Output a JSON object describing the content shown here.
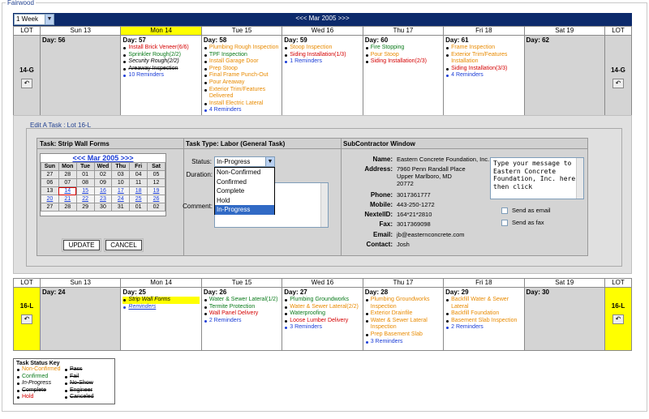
{
  "page": {
    "fieldset_label": "Fairwood"
  },
  "top_calendar": {
    "week_select": "1 Week",
    "month_nav": "<<< Mar 2005 >>>",
    "lot_header": "LOT",
    "lot": "14-G",
    "days": [
      {
        "header": "Sun 13",
        "day": "Day: 56",
        "gray": true,
        "tasks": []
      },
      {
        "header": "Mon 14",
        "day": "Day: 57",
        "today": true,
        "tasks": [
          {
            "text": "Install Brick Veneer(6/6)",
            "cls": "c-red"
          },
          {
            "text": "Sprinkler Rough(2/2)",
            "cls": "c-green"
          },
          {
            "text": "Security Rough(2/2)",
            "cls": "c-italic"
          },
          {
            "text": "Areaway Inspection",
            "cls": "c-strike"
          },
          {
            "text": "10 Reminders",
            "cls": "c-blue",
            "rem": true
          }
        ]
      },
      {
        "header": "Tue 15",
        "day": "Day: 58",
        "tasks": [
          {
            "text": "Plumbing Rough Inspection",
            "cls": "c-orange"
          },
          {
            "text": "TPF Inspection",
            "cls": "c-green"
          },
          {
            "text": "Install Garage Door",
            "cls": "c-orange"
          },
          {
            "text": "Prep Stoop",
            "cls": "c-orange"
          },
          {
            "text": "Final Frame Punch-Out",
            "cls": "c-orange"
          },
          {
            "text": "Pour Areaway",
            "cls": "c-orange"
          },
          {
            "text": "Exterior Trim/Features Delivered",
            "cls": "c-orange"
          },
          {
            "text": "Install Electric Lateral",
            "cls": "c-orange"
          },
          {
            "text": "4 Reminders",
            "cls": "c-blue",
            "rem": true
          }
        ]
      },
      {
        "header": "Wed 16",
        "day": "Day: 59",
        "tasks": [
          {
            "text": "Stoop Inspection",
            "cls": "c-orange"
          },
          {
            "text": "Siding Installation(1/3)",
            "cls": "c-red"
          },
          {
            "text": "1 Reminders",
            "cls": "c-blue",
            "rem": true
          }
        ]
      },
      {
        "header": "Thu 17",
        "day": "Day: 60",
        "tasks": [
          {
            "text": "Fire Stopping",
            "cls": "c-green"
          },
          {
            "text": "Pour Stoop",
            "cls": "c-orange"
          },
          {
            "text": "Siding Installation(2/3)",
            "cls": "c-red"
          }
        ]
      },
      {
        "header": "Fri 18",
        "day": "Day: 61",
        "tasks": [
          {
            "text": "Frame Inspection",
            "cls": "c-orange"
          },
          {
            "text": "Exterior Trim/Features Installation",
            "cls": "c-orange"
          },
          {
            "text": "Siding Installation(3/3)",
            "cls": "c-red"
          },
          {
            "text": "4 Reminders",
            "cls": "c-blue",
            "rem": true
          }
        ]
      },
      {
        "header": "Sat 19",
        "day": "Day: 62",
        "gray": true,
        "tasks": []
      }
    ]
  },
  "edit": {
    "legend": "Edit A Task : Lot 16-L",
    "task_title": "Task: Strip Wall Forms",
    "task_type": "Task Type: Labor (General Task)",
    "sub_window": "SubContractor Window",
    "mini_month": "<<< Mar 2005 >>>",
    "dow": [
      "Sun",
      "Mon",
      "Tue",
      "Wed",
      "Thu",
      "Fri",
      "Sat"
    ],
    "weeks": [
      [
        "27",
        "28",
        "01",
        "02",
        "03",
        "04",
        "05"
      ],
      [
        "06",
        "07",
        "08",
        "09",
        "10",
        "11",
        "12"
      ],
      [
        "13",
        "14",
        "15",
        "16",
        "17",
        "18",
        "19"
      ],
      [
        "20",
        "21",
        "22",
        "23",
        "24",
        "25",
        "26"
      ],
      [
        "27",
        "28",
        "29",
        "30",
        "31",
        "01",
        "02"
      ]
    ],
    "update_label": "UPDATE",
    "cancel_label": "CANCEL",
    "status_label": "Status:",
    "duration_label": "Duration:",
    "comment_label": "Comment:",
    "status_value": "In-Progress",
    "status_options": [
      "Non-Confirmed",
      "Confirmed",
      "Complete",
      "Hold",
      "In-Progress"
    ],
    "sub": {
      "name_label": "Name:",
      "name": "Eastern Concrete Foundation, Inc.",
      "address_label": "Address:",
      "address1": "7960 Penn Randall Place",
      "address2": "Upper Marlboro, MD",
      "address3": "20772",
      "phone_label": "Phone:",
      "phone": "3017361777",
      "mobile_label": "Mobile:",
      "mobile": "443-250-1272",
      "nextel_label": "NextelID:",
      "nextel": "164*21*2810",
      "fax_label": "Fax:",
      "fax": "3017369098",
      "email_label": "Email:",
      "email": "jb@easternconcrete.com",
      "contact_label": "Contact:",
      "contact": "Josh",
      "message": "Type your message to Eastern Concrete Foundation, Inc. here, then click",
      "send_email": "Send as email",
      "send_fax": "Send as fax"
    }
  },
  "bottom_calendar": {
    "lot_header": "LOT",
    "lot": "16-L",
    "days": [
      {
        "header": "Sun 13",
        "day": "Day: 24",
        "gray": true,
        "tasks": []
      },
      {
        "header": "Mon 14",
        "day": "Day: 25",
        "tasks": [
          {
            "text": "Strip Wall Forms",
            "cls": "c-hl"
          },
          {
            "text": "Reminders",
            "cls": "c-hlu",
            "rem": true
          }
        ]
      },
      {
        "header": "Tue 15",
        "day": "Day: 26",
        "tasks": [
          {
            "text": "Water & Sewer Lateral(1/2)",
            "cls": "c-green"
          },
          {
            "text": "Termite Protection",
            "cls": "c-green"
          },
          {
            "text": "Wall Panel Delivery",
            "cls": "c-red"
          },
          {
            "text": "2 Reminders",
            "cls": "c-blue",
            "rem": true
          }
        ]
      },
      {
        "header": "Wed 16",
        "day": "Day: 27",
        "tasks": [
          {
            "text": "Plumbing Groundworks",
            "cls": "c-green"
          },
          {
            "text": "Water & Sewer Lateral(2/2)",
            "cls": "c-orange"
          },
          {
            "text": "Waterproofing",
            "cls": "c-green"
          },
          {
            "text": "Loose Lumber Delivery",
            "cls": "c-red"
          },
          {
            "text": "3 Reminders",
            "cls": "c-blue",
            "rem": true
          }
        ]
      },
      {
        "header": "Thu 17",
        "day": "Day: 28",
        "tasks": [
          {
            "text": "Plumbing Groundworks Inspection",
            "cls": "c-orange"
          },
          {
            "text": "Exterior Drainfile",
            "cls": "c-orange"
          },
          {
            "text": "Water & Sewer Lateral Inspection",
            "cls": "c-orange"
          },
          {
            "text": "Prep Basement Slab",
            "cls": "c-orange"
          },
          {
            "text": "3 Reminders",
            "cls": "c-blue",
            "rem": true
          }
        ]
      },
      {
        "header": "Fri 18",
        "day": "Day: 29",
        "tasks": [
          {
            "text": "Backfill Water & Sewer Lateral",
            "cls": "c-orange"
          },
          {
            "text": "Backfill Foundation",
            "cls": "c-orange"
          },
          {
            "text": "Basement Slab Inspection",
            "cls": "c-orange"
          },
          {
            "text": "2 Reminders",
            "cls": "c-blue",
            "rem": true
          }
        ]
      },
      {
        "header": "Sat 19",
        "day": "Day: 30",
        "gray": true,
        "tasks": []
      }
    ]
  },
  "key": {
    "title": "Task Status Key",
    "col1": [
      {
        "text": "Non-Confirmed",
        "cls": "c-orange"
      },
      {
        "text": "Confirmed",
        "cls": "c-green"
      },
      {
        "text": "In-Progress",
        "cls": "c-italic"
      },
      {
        "text": "Complete",
        "cls": "c-strike"
      },
      {
        "text": "Hold",
        "cls": "c-red"
      }
    ],
    "col2": [
      {
        "text": "Pass",
        "cls": "c-strike"
      },
      {
        "text": "Fail",
        "cls": "c-strike"
      },
      {
        "text": "No-Show",
        "cls": "c-strike"
      },
      {
        "text": "Engineer",
        "cls": "c-strike"
      },
      {
        "text": "Canceled",
        "cls": "c-strike"
      }
    ]
  }
}
